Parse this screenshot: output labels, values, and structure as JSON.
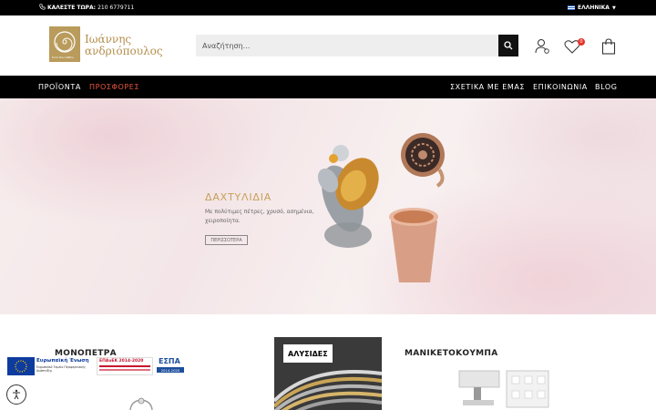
{
  "topbar": {
    "call_label": "ΚΑΛΕΣΤΕ ΤΩΡΑ:",
    "phone": "210 6779711",
    "language": "ΕΛΛΗΝΙΚΑ"
  },
  "header": {
    "logo_line1": "Ιωάννης",
    "logo_line2": "ανδριόπουλος",
    "logo_badge": "from the 1980's",
    "search_placeholder": "Αναζήτηση...",
    "wishlist_count": "0"
  },
  "nav": {
    "products": "ΠΡΟΪΟΝΤΑ",
    "offers": "ΠΡΟΣΦΟΡΕΣ",
    "about": "ΣΧΕΤΙΚΑ ΜΕ ΕΜΑΣ",
    "contact": "ΕΠΙΚΟΙΝΩΝΙΑ",
    "blog": "BLOG"
  },
  "hero": {
    "title": "ΔΑΧΤΥΛΙΔΙΑ",
    "description": "Με πολύτιμες πέτρες, χρυσό, ασημένια, χειροποίητα.",
    "button": "ΠΕΡΙΣΣΟΤΕΡΑ"
  },
  "categories": {
    "single_stone": "ΜΟΝΟΠΕΤΡΑ",
    "chains": "ΑΛΥΣΙΔΕΣ",
    "cufflinks": "ΜΑΝΙΚΕΤΟΚΟΥΜΠΑ"
  },
  "eu_banner": {
    "eu": "Ευρωπαϊκή Ένωση",
    "eu_sub": "Ευρωπαϊκό Ταμείο Περιφερειακής Ανάπτυξης",
    "epanek": "ΕΠΑνΕΚ 2014-2020",
    "espa": "ΕΣΠΑ",
    "espa_years": "2014-2020"
  },
  "colors": {
    "accent_gold": "#c7a05a",
    "promo_red": "#e9563f",
    "badge_red": "#e5322d"
  }
}
